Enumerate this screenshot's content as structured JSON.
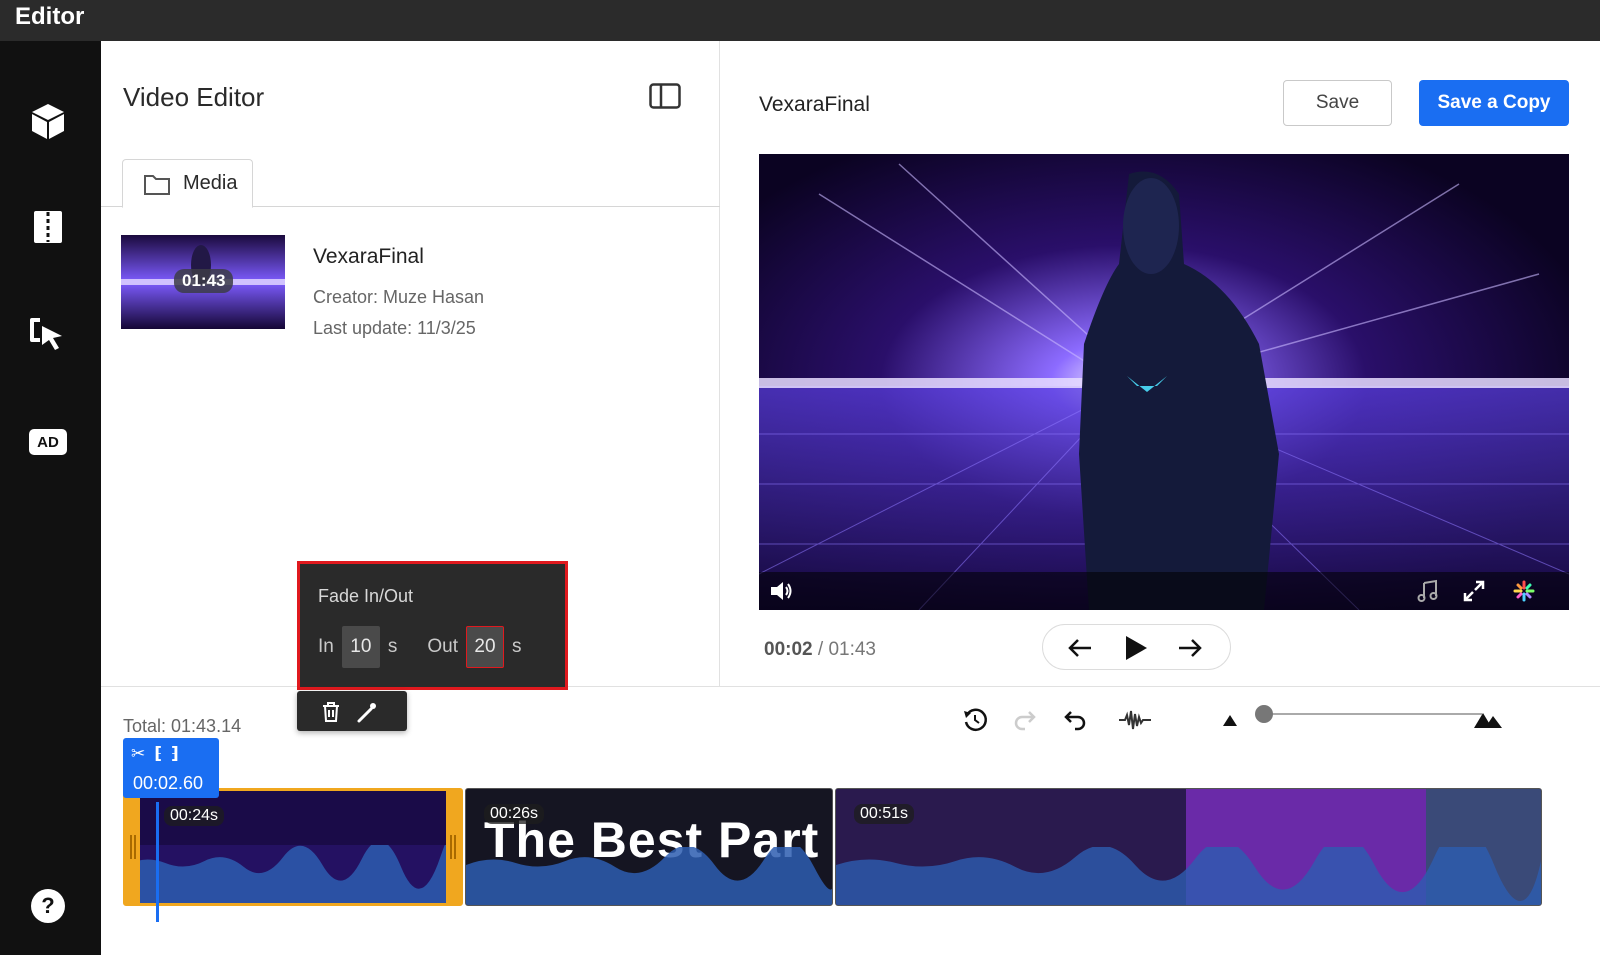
{
  "app": {
    "title": "Editor"
  },
  "rail": {
    "ad_label": "AD",
    "help_label": "?"
  },
  "media_panel": {
    "title": "Video Editor",
    "tab_label": "Media",
    "item": {
      "duration": "01:43",
      "name": "VexaraFinal",
      "creator": "Creator: Muze Hasan",
      "last_update": "Last update: 11/3/25"
    }
  },
  "preview": {
    "title": "VexaraFinal",
    "save_label": "Save",
    "save_copy_label": "Save a Copy",
    "current_time": "00:02",
    "separator": "/",
    "total_time": "01:43"
  },
  "fade": {
    "title": "Fade In/Out",
    "in_label": "In",
    "in_value": "10",
    "in_unit": "s",
    "out_label": "Out",
    "out_value": "20",
    "out_unit": "s"
  },
  "timeline": {
    "total": "Total: 01:43.14",
    "split_time": "00:02.60",
    "zoom_level": 0.02,
    "clips": [
      {
        "duration": "00:24s"
      },
      {
        "duration": "00:26s",
        "caption": "The Best Part"
      },
      {
        "duration": "00:51s"
      }
    ]
  },
  "colors": {
    "accent": "#1a6ef2",
    "selection": "#f0a71f",
    "highlight": "#e0191e",
    "topbar": "#2b2b2b",
    "rail": "#111111"
  },
  "icons": [
    "cube-icon",
    "split-columns-icon",
    "cursor-click-icon",
    "ad-icon",
    "help-icon",
    "layout-toggle-icon",
    "folder-icon",
    "volume-icon",
    "music-note-icon",
    "fullscreen-icon",
    "color-wheel-icon",
    "arrow-left-icon",
    "play-icon",
    "arrow-right-icon",
    "history-icon",
    "redo-icon",
    "undo-icon",
    "waveform-icon",
    "mountain-small-icon",
    "mountain-large-icon",
    "scissors-icon",
    "trim-start-icon",
    "trim-end-icon",
    "trash-icon",
    "magic-wand-icon"
  ]
}
